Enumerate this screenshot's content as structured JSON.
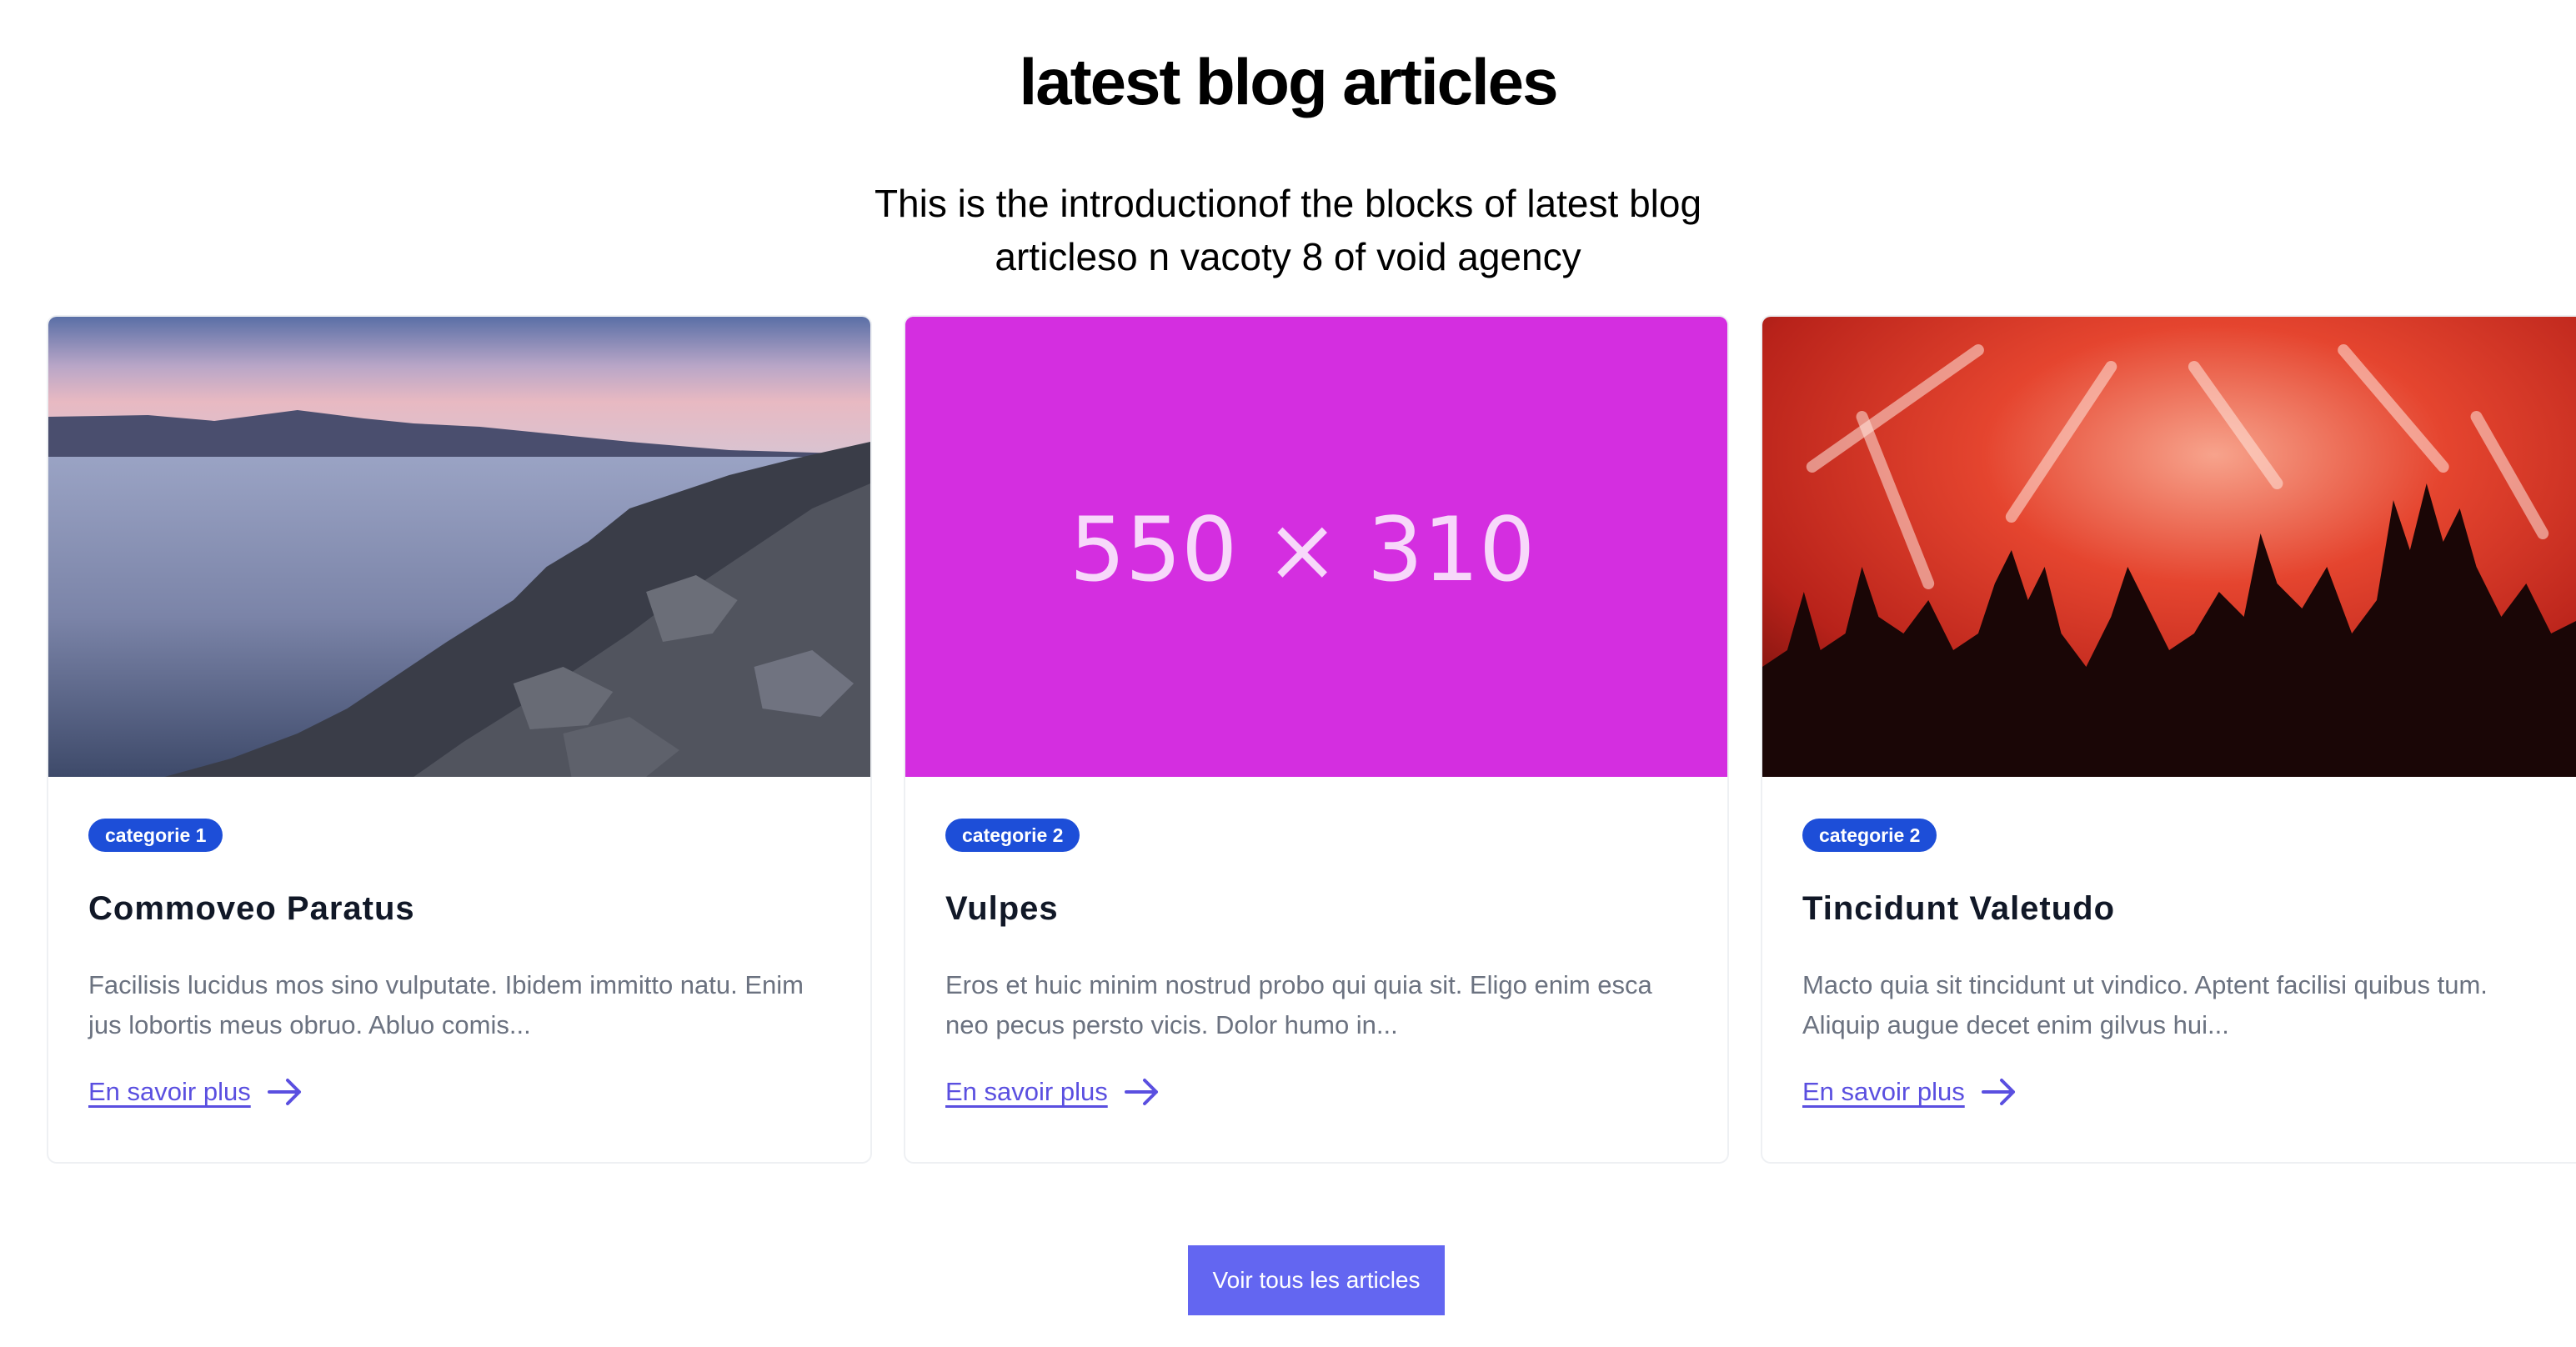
{
  "section": {
    "title": "latest blog articles",
    "intro": "This is the introductionof the blocks of latest blog articleso n vacoty 8 of void agency"
  },
  "articles": [
    {
      "image": "coastline-sunset-photo",
      "category": "categorie 1",
      "title": "Commoveo Paratus",
      "excerpt": "Facilisis lucidus mos sino vulputate. Ibidem immitto natu. Enim jus lobortis meus obruo. Abluo comis...",
      "link_label": "En savoir plus"
    },
    {
      "image": "placeholder",
      "image_label": "550 × 310",
      "image_color": "#d42ee0",
      "category": "categorie 2",
      "title": "Vulpes",
      "excerpt": "Eros et huic minim nostrud probo qui quia sit. Eligo enim esca neo pecus persto vicis. Dolor humo in...",
      "link_label": "En savoir plus"
    },
    {
      "image": "concert-crowd-photo",
      "category": "categorie 2",
      "title": "Tincidunt Valetudo",
      "excerpt": "Macto quia sit tincidunt ut vindico. Aptent facilisi quibus tum. Aliquip augue decet enim gilvus hui...",
      "link_label": "En savoir plus"
    }
  ],
  "cta": {
    "label": "Voir tous les articles"
  },
  "colors": {
    "badge": "#1d4ed8",
    "link": "#5a4fe0",
    "button": "#6366f1",
    "excerpt": "#6b7280"
  }
}
